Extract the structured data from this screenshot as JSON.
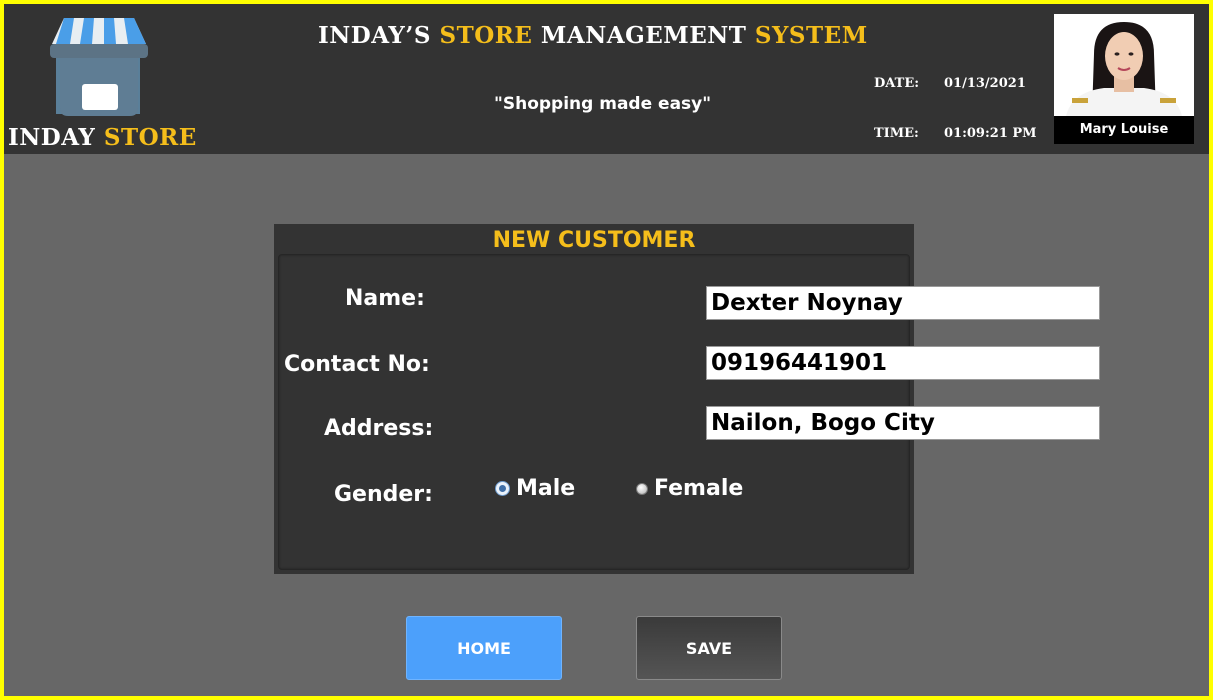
{
  "logo": {
    "text_part1": "INDAY",
    "text_part2": "STORE"
  },
  "header": {
    "title_part1": "INDAY’S",
    "title_part2": "STORE",
    "title_part3": "MANAGEMENT",
    "title_part4": "SYSTEM",
    "tagline": "\"Shopping made easy\"",
    "date_label": "DATE:",
    "date_value": "01/13/2021",
    "time_label": "TIME:",
    "time_value": "01:09:21 PM",
    "user_name": "Mary Louise"
  },
  "form": {
    "title": "NEW CUSTOMER",
    "name_label": "Name:",
    "name_value": "Dexter Noynay",
    "contact_label": "Contact No:",
    "contact_value": "09196441901",
    "address_label": "Address:",
    "address_value": "Nailon, Bogo City",
    "gender_label": "Gender:",
    "gender_options": [
      "Male",
      "Female"
    ],
    "gender_selected": "Male"
  },
  "buttons": {
    "home": "HOME",
    "save": "SAVE"
  },
  "colors": {
    "accent_yellow": "#f5be1b",
    "home_blue": "#4ca0fb",
    "frame_yellow": "#ffff00"
  }
}
